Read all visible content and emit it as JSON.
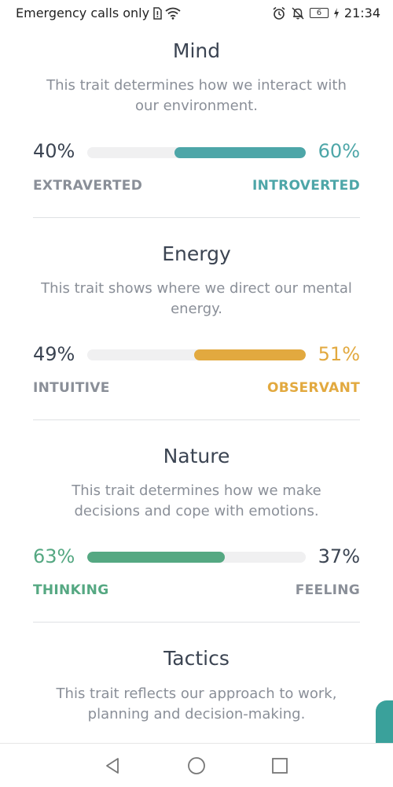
{
  "status_bar": {
    "carrier_text": "Emergency calls only",
    "battery_level": "6",
    "time": "21:34",
    "icons": [
      "sim-alert-icon",
      "wifi-icon",
      "alarm-icon",
      "notifications-off-icon",
      "battery-icon",
      "charging-icon"
    ]
  },
  "sections": [
    {
      "title": "Mind",
      "description": "This trait determines how we interact with our environment.",
      "left_pct": "40%",
      "right_pct": "60%",
      "left_label": "EXTRAVERTED",
      "right_label": "INTROVERTED",
      "dominant": "right",
      "dominant_fraction": 0.6,
      "color": "#4da6a8"
    },
    {
      "title": "Energy",
      "description": "This trait shows where we direct our mental energy.",
      "left_pct": "49%",
      "right_pct": "51%",
      "left_label": "INTUITIVE",
      "right_label": "OBSERVANT",
      "dominant": "right",
      "dominant_fraction": 0.51,
      "color": "#e2a93f"
    },
    {
      "title": "Nature",
      "description": "This trait determines how we make decisions and cope with emotions.",
      "left_pct": "63%",
      "right_pct": "37%",
      "left_label": "THINKING",
      "right_label": "FEELING",
      "dominant": "left",
      "dominant_fraction": 0.63,
      "color": "#55a882"
    },
    {
      "title": "Tactics",
      "description": "This trait reflects our approach to work, planning and decision-making."
    }
  ],
  "colors": {
    "neutral_text": "#3b4452",
    "muted_label": "#8a8f98",
    "accent_tab": "#3aa19b"
  },
  "nav_bar": {
    "icons": [
      "back-icon",
      "home-icon",
      "recents-icon"
    ]
  }
}
